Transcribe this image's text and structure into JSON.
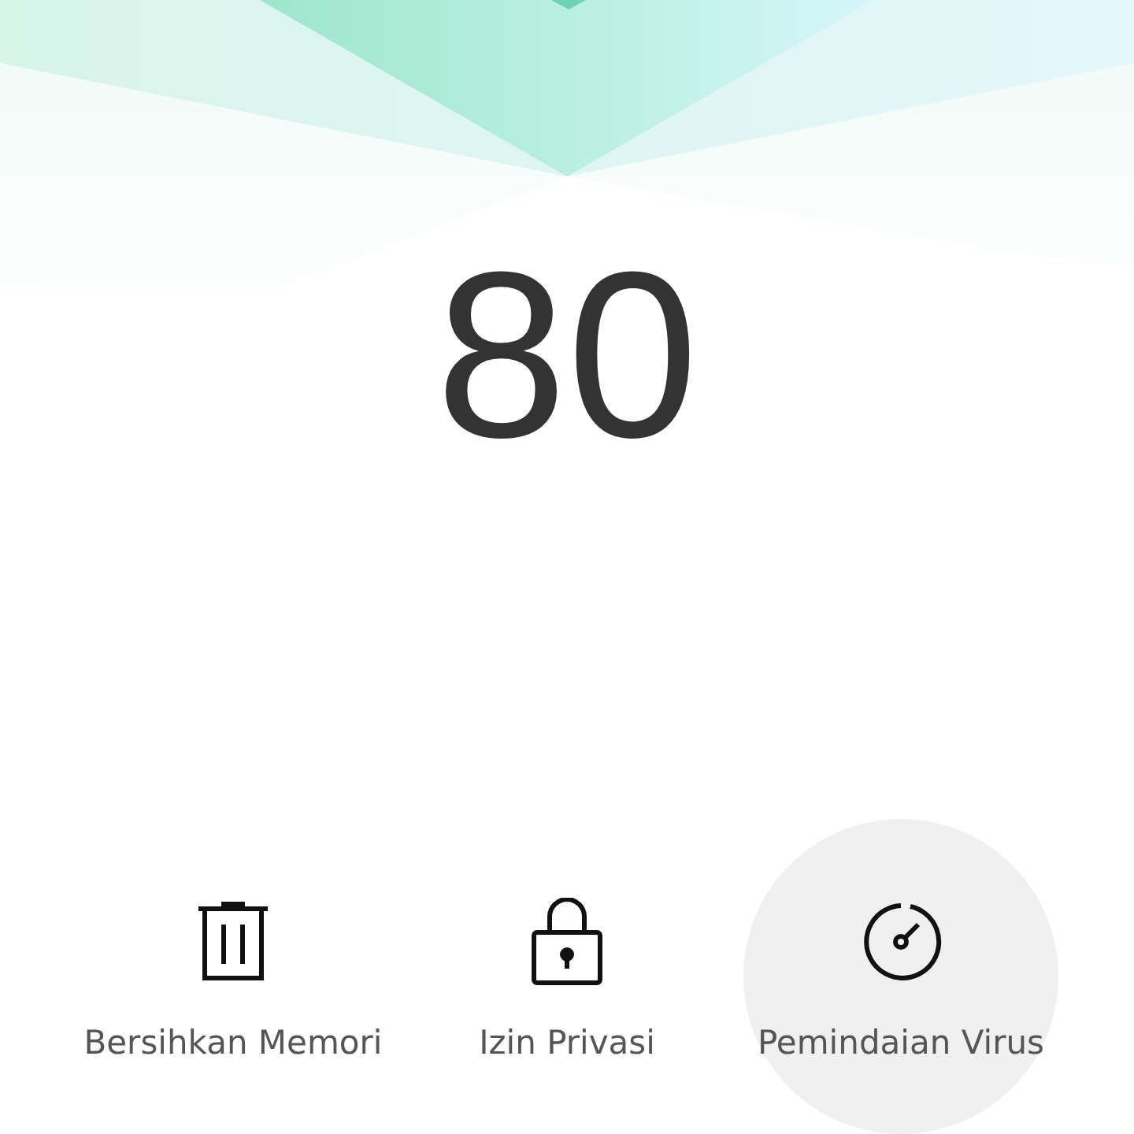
{
  "score": "80",
  "actions": [
    {
      "kind": "trash",
      "label": "Bersihkan Memori",
      "highlighted": false
    },
    {
      "kind": "lock",
      "label": "Izin Privasi",
      "highlighted": false
    },
    {
      "kind": "gauge",
      "label": "Pemindaian Virus",
      "highlighted": true
    }
  ]
}
